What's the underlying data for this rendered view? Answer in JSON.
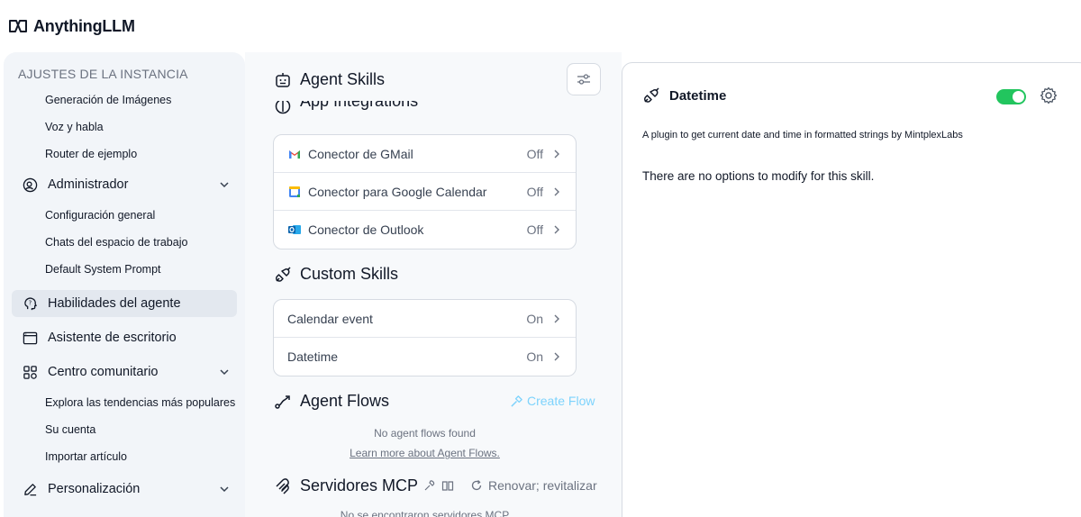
{
  "app": {
    "title": "AnythingLLM"
  },
  "sidebar": {
    "heading": "AJUSTES DE LA INSTANCIA",
    "instance_items": [
      "Generación de Imágenes",
      "Voz y habla",
      "Router de ejemplo"
    ],
    "admin": {
      "label": "Administrador",
      "icon": "user-gear-icon"
    },
    "admin_items": [
      "Configuración general",
      "Chats del espacio de trabajo",
      "Default System Prompt"
    ],
    "agent_skills": {
      "label": "Habilidades del agente",
      "icon": "brain-icon"
    },
    "desktop": {
      "label": "Asistente de escritorio",
      "icon": "browser-window-icon"
    },
    "community": {
      "label": "Centro comunitario",
      "icon": "grid-icon"
    },
    "community_items": [
      "Explora las tendencias más populares",
      "Su cuenta",
      "Importar artículo"
    ],
    "personalization": {
      "label": "Personalización",
      "icon": "pencil-icon"
    }
  },
  "middle": {
    "agent_skills_title": "Agent Skills",
    "app_integrations_title": "App Integrations",
    "integrations": [
      {
        "label": "Conector de GMail",
        "state": "Off",
        "icon": "gmail-icon"
      },
      {
        "label": "Conector para Google Calendar",
        "state": "Off",
        "icon": "google-calendar-icon"
      },
      {
        "label": "Conector de Outlook",
        "state": "Off",
        "icon": "outlook-icon"
      }
    ],
    "custom_skills_title": "Custom Skills",
    "custom_skills": [
      {
        "label": "Calendar event",
        "state": "On"
      },
      {
        "label": "Datetime",
        "state": "On"
      }
    ],
    "agent_flows_title": "Agent Flows",
    "create_flow": "Create Flow",
    "no_flows": "No agent flows found",
    "learn_more": "Learn more about Agent Flows.",
    "mcp_title": "Servidores MCP",
    "refresh": "Renovar; revitalizar",
    "no_mcp": "No se encontraron servidores MCP"
  },
  "detail": {
    "title": "Datetime",
    "enabled": true,
    "description": "A plugin to get current date and time in formatted strings by MintplexLabs",
    "note": "There are no options to modify for this skill."
  },
  "colors": {
    "toggle_on": "#22c55e",
    "create_flow": "#7dd3fc",
    "sidebar_bg": "#f2f5f9"
  }
}
